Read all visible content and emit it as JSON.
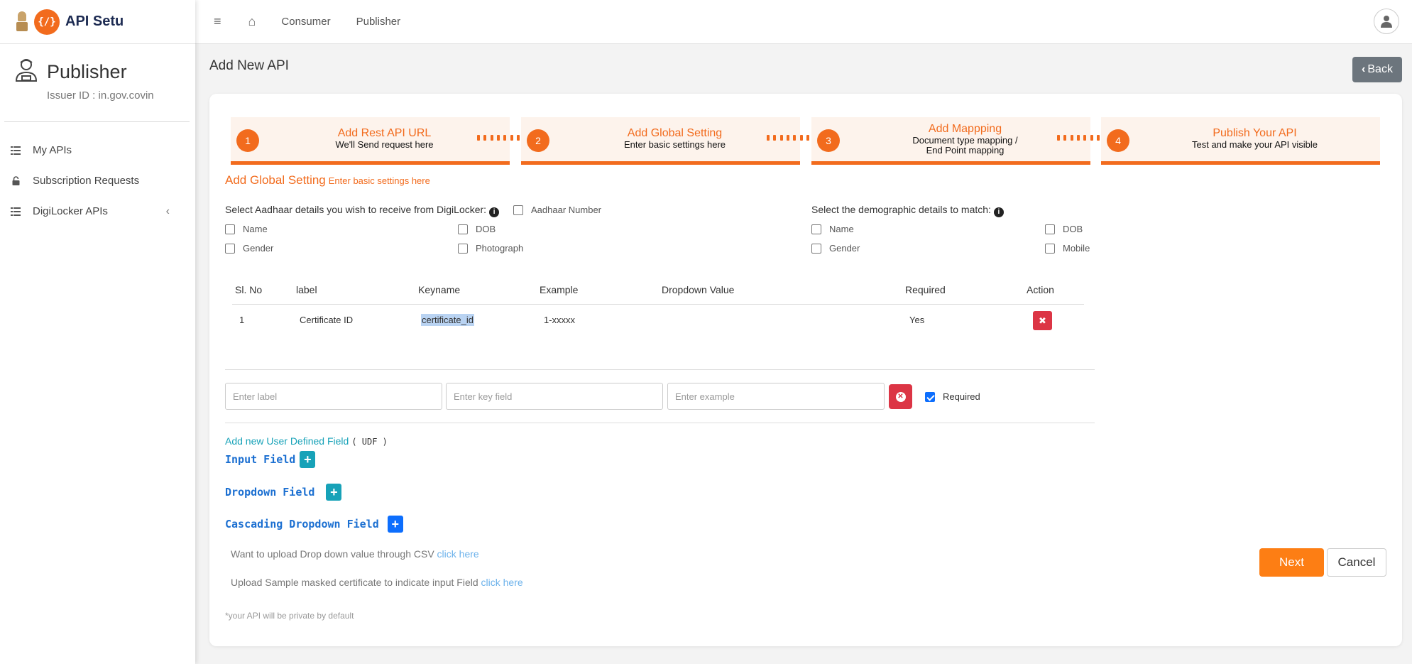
{
  "app": {
    "name": "API Setu",
    "logo_text": "{/}"
  },
  "sidebar": {
    "profile_title": "Publisher",
    "profile_sub": "Issuer ID : in.gov.covin",
    "items": [
      {
        "label": "My APIs",
        "icon": "list-icon"
      },
      {
        "label": "Subscription Requests",
        "icon": "lock-icon"
      },
      {
        "label": "DigiLocker APIs",
        "icon": "list-icon",
        "chevron": "‹"
      }
    ]
  },
  "topbar": {
    "menu_icon": "≡",
    "home_icon": "⌂",
    "links": [
      "Consumer",
      "Publisher"
    ]
  },
  "page": {
    "title": "Add New API",
    "back_label": "Back",
    "back_icon": "‹"
  },
  "stepper": [
    {
      "num": "1",
      "title": "Add Rest API URL",
      "sub": "We'll Send request here"
    },
    {
      "num": "2",
      "title": "Add Global Setting",
      "sub": "Enter basic settings here"
    },
    {
      "num": "3",
      "title": "Add Mappping",
      "sub": "Document type mapping /",
      "sub2": "End Point mapping"
    },
    {
      "num": "4",
      "title": "Publish Your API",
      "sub": "Test and make your API visible"
    }
  ],
  "section": {
    "title": "Add Global Setting",
    "subtitle": "Enter basic settings here"
  },
  "aadhaar": {
    "label": "Select Aadhaar details you wish to receive from DigiLocker:",
    "info_icon": "i",
    "options": [
      "Aadhaar Number",
      "Name",
      "DOB",
      "Gender",
      "Photograph"
    ]
  },
  "demographic": {
    "label": "Select the demographic details to match:",
    "info_icon": "i",
    "options": [
      "Name",
      "DOB",
      "Gender",
      "Mobile"
    ]
  },
  "table": {
    "headers": [
      "Sl. No",
      "label",
      "Keyname",
      "Example",
      "Dropdown Value",
      "Required",
      "Action"
    ],
    "rows": [
      {
        "sl": "1",
        "label": "Certificate ID",
        "keyname": "certificate_id",
        "example": "1-xxxxx",
        "dropdown": "",
        "required": "Yes",
        "action_icon": "✖"
      }
    ]
  },
  "new_field": {
    "label_placeholder": "Enter label",
    "key_placeholder": "Enter key field",
    "example_placeholder": "Enter example",
    "clear_icon": "✕",
    "required_label": "Required",
    "required_checked": true
  },
  "udf": {
    "link_text": "Add new User Defined Field",
    "code": "( UDF )",
    "fields": [
      "Input Field",
      "Dropdown Field",
      "Cascading Dropdown Field"
    ],
    "plus": "+"
  },
  "notes": {
    "csv_text": "Want to upload Drop down value through CSV",
    "csv_link": "click here",
    "sample_text": "Upload Sample masked certificate to indicate input Field",
    "sample_link": "click here",
    "private": "*your API will be private by default"
  },
  "actions": {
    "next": "Next",
    "cancel": "Cancel"
  },
  "colors": {
    "accent": "#f26b1d",
    "danger": "#dc3545",
    "teal": "#17a2b8",
    "primary": "#0d6efd"
  }
}
